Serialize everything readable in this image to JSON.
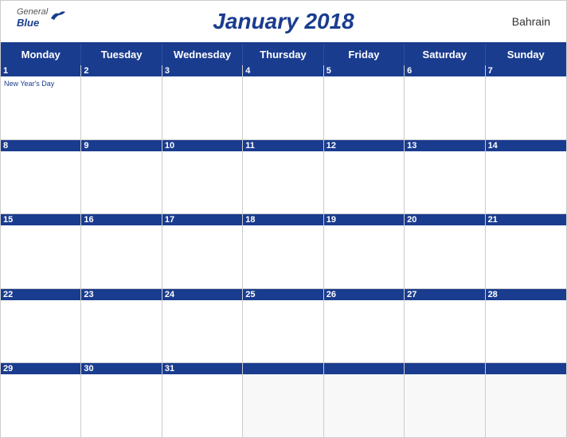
{
  "header": {
    "title": "January 2018",
    "country": "Bahrain",
    "logo": {
      "general": "General",
      "blue": "Blue"
    }
  },
  "dayHeaders": [
    "Monday",
    "Tuesday",
    "Wednesday",
    "Thursday",
    "Friday",
    "Saturday",
    "Sunday"
  ],
  "weeks": [
    [
      {
        "day": 1,
        "holiday": "New Year's Day"
      },
      {
        "day": 2
      },
      {
        "day": 3
      },
      {
        "day": 4
      },
      {
        "day": 5
      },
      {
        "day": 6
      },
      {
        "day": 7
      }
    ],
    [
      {
        "day": 8
      },
      {
        "day": 9
      },
      {
        "day": 10
      },
      {
        "day": 11
      },
      {
        "day": 12
      },
      {
        "day": 13
      },
      {
        "day": 14
      }
    ],
    [
      {
        "day": 15
      },
      {
        "day": 16
      },
      {
        "day": 17
      },
      {
        "day": 18
      },
      {
        "day": 19
      },
      {
        "day": 20
      },
      {
        "day": 21
      }
    ],
    [
      {
        "day": 22
      },
      {
        "day": 23
      },
      {
        "day": 24
      },
      {
        "day": 25
      },
      {
        "day": 26
      },
      {
        "day": 27
      },
      {
        "day": 28
      }
    ],
    [
      {
        "day": 29
      },
      {
        "day": 30
      },
      {
        "day": 31
      },
      {
        "day": null
      },
      {
        "day": null
      },
      {
        "day": null
      },
      {
        "day": null
      }
    ]
  ]
}
